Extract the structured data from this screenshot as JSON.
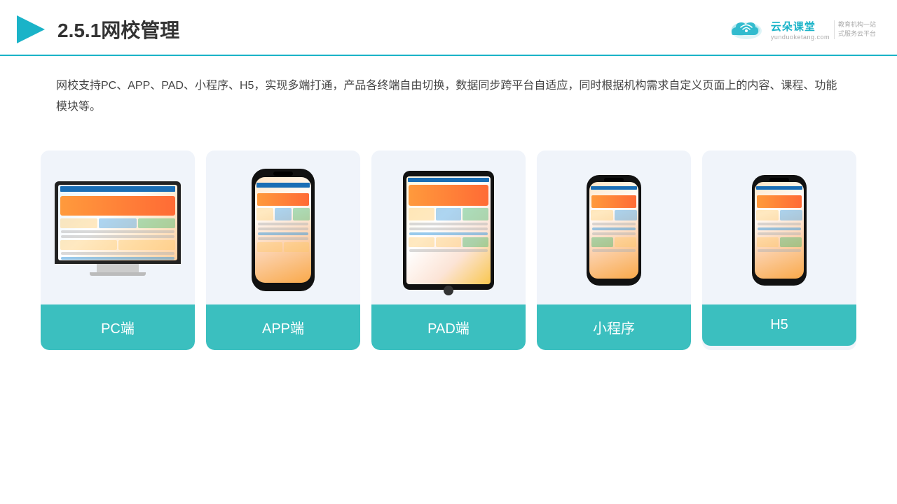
{
  "header": {
    "title": "2.5.1网校管理",
    "logo_main": "云朵课堂",
    "logo_url": "yunduoketang.com",
    "logo_tagline1": "教育机构一站",
    "logo_tagline2": "式服务云平台"
  },
  "description": {
    "text": "网校支持PC、APP、PAD、小程序、H5，实现多端打通，产品各终端自由切换，数据同步跨平台自适应，同时根据机构需求自定义页面上的内容、课程、功能模块等。"
  },
  "cards": [
    {
      "id": "pc",
      "label": "PC端",
      "type": "monitor"
    },
    {
      "id": "app",
      "label": "APP端",
      "type": "phone_tall"
    },
    {
      "id": "pad",
      "label": "PAD端",
      "type": "tablet"
    },
    {
      "id": "miniapp",
      "label": "小程序",
      "type": "phone"
    },
    {
      "id": "h5",
      "label": "H5",
      "type": "phone"
    }
  ]
}
